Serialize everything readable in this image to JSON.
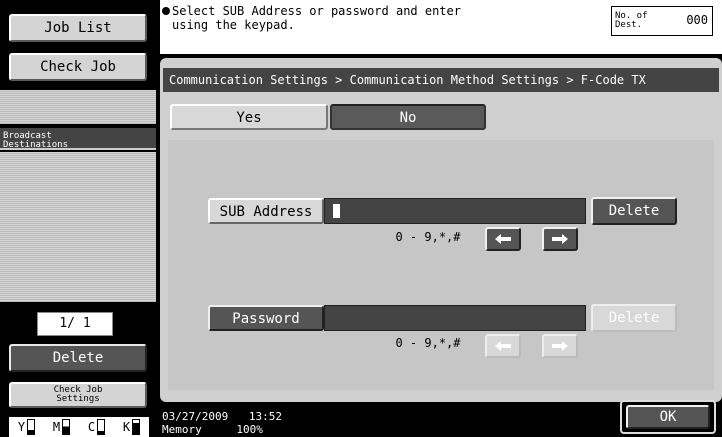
{
  "left_panel": {
    "job_list": "Job List",
    "check_job": "Check Job",
    "broadcast_destinations": "Broadcast Destinations",
    "page_counter": "1/ 1",
    "delete": "Delete",
    "check_job_settings": "Check Job Settings",
    "toner": [
      "Y",
      "M",
      "C",
      "K"
    ]
  },
  "message": {
    "instruction": "Select SUB Address or password and enter using the keypad.",
    "dest_label": "No. of Dest.",
    "dest_count": "000"
  },
  "breadcrumb": "Communication Settings > Communication Method Settings > F-Code TX",
  "toggle": {
    "yes": "Yes",
    "no": "No",
    "selected": "No"
  },
  "sub_address": {
    "button": "SUB Address",
    "value": "",
    "hint": "0 - 9,*,#",
    "delete": "Delete"
  },
  "password": {
    "button": "Password",
    "value": "",
    "hint": "0 - 9,*,#",
    "delete": "Delete"
  },
  "footer": {
    "date": "03/27/2009",
    "time": "13:52",
    "memory_label": "Memory",
    "memory_value": "100%",
    "ok": "OK"
  },
  "colors": {
    "accent_dark": "#555555",
    "panel_gray": "#cfcfcf"
  }
}
